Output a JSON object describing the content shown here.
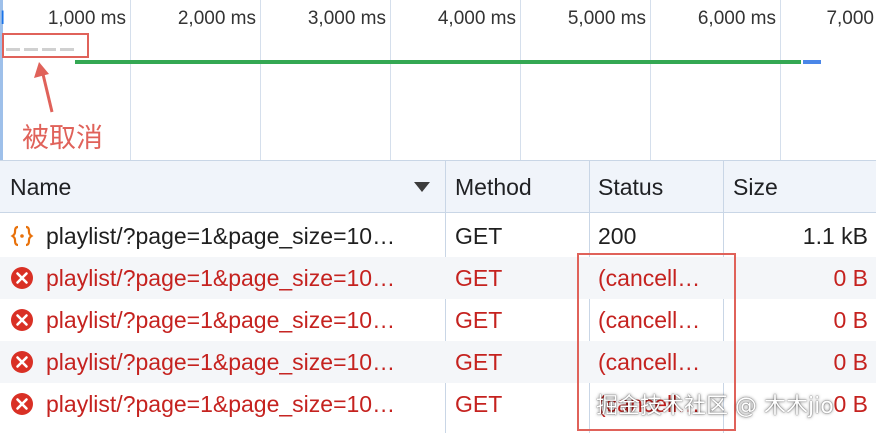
{
  "timeline": {
    "first_tick_mark": "I",
    "ticks": [
      "1,000 ms",
      "2,000 ms",
      "3,000 ms",
      "4,000 ms",
      "5,000 ms",
      "6,000 ms",
      "7,000"
    ],
    "annotation": "被取消",
    "colors": {
      "waiting_bar": "#34a853",
      "download_bar": "#4a86e8",
      "annotation": "#e0625a"
    }
  },
  "table": {
    "columns": {
      "name": "Name",
      "method": "Method",
      "status": "Status",
      "size": "Size"
    },
    "sort": {
      "column": "name",
      "icon": "sort-descending-triangle"
    },
    "rows": [
      {
        "icon": "xhr-braces-icon",
        "name": "playlist/?page=1&page_size=10…",
        "method": "GET",
        "status": "200",
        "size": "1.1 kB",
        "state": "ok"
      },
      {
        "icon": "error-icon",
        "name": "playlist/?page=1&page_size=10…",
        "method": "GET",
        "status": "(cancell…",
        "size": "0 B",
        "state": "err"
      },
      {
        "icon": "error-icon",
        "name": "playlist/?page=1&page_size=10…",
        "method": "GET",
        "status": "(cancell…",
        "size": "0 B",
        "state": "err"
      },
      {
        "icon": "error-icon",
        "name": "playlist/?page=1&page_size=10…",
        "method": "GET",
        "status": "(cancell…",
        "size": "0 B",
        "state": "err"
      },
      {
        "icon": "error-icon",
        "name": "playlist/?page=1&page_size=10…",
        "method": "GET",
        "status": "(cancell…",
        "size": "0 B",
        "state": "err"
      }
    ],
    "colors": {
      "error_text": "#c5221f",
      "header_bg": "#f0f4fa"
    }
  },
  "watermark": "掘金技术社区 @ 木木jio"
}
